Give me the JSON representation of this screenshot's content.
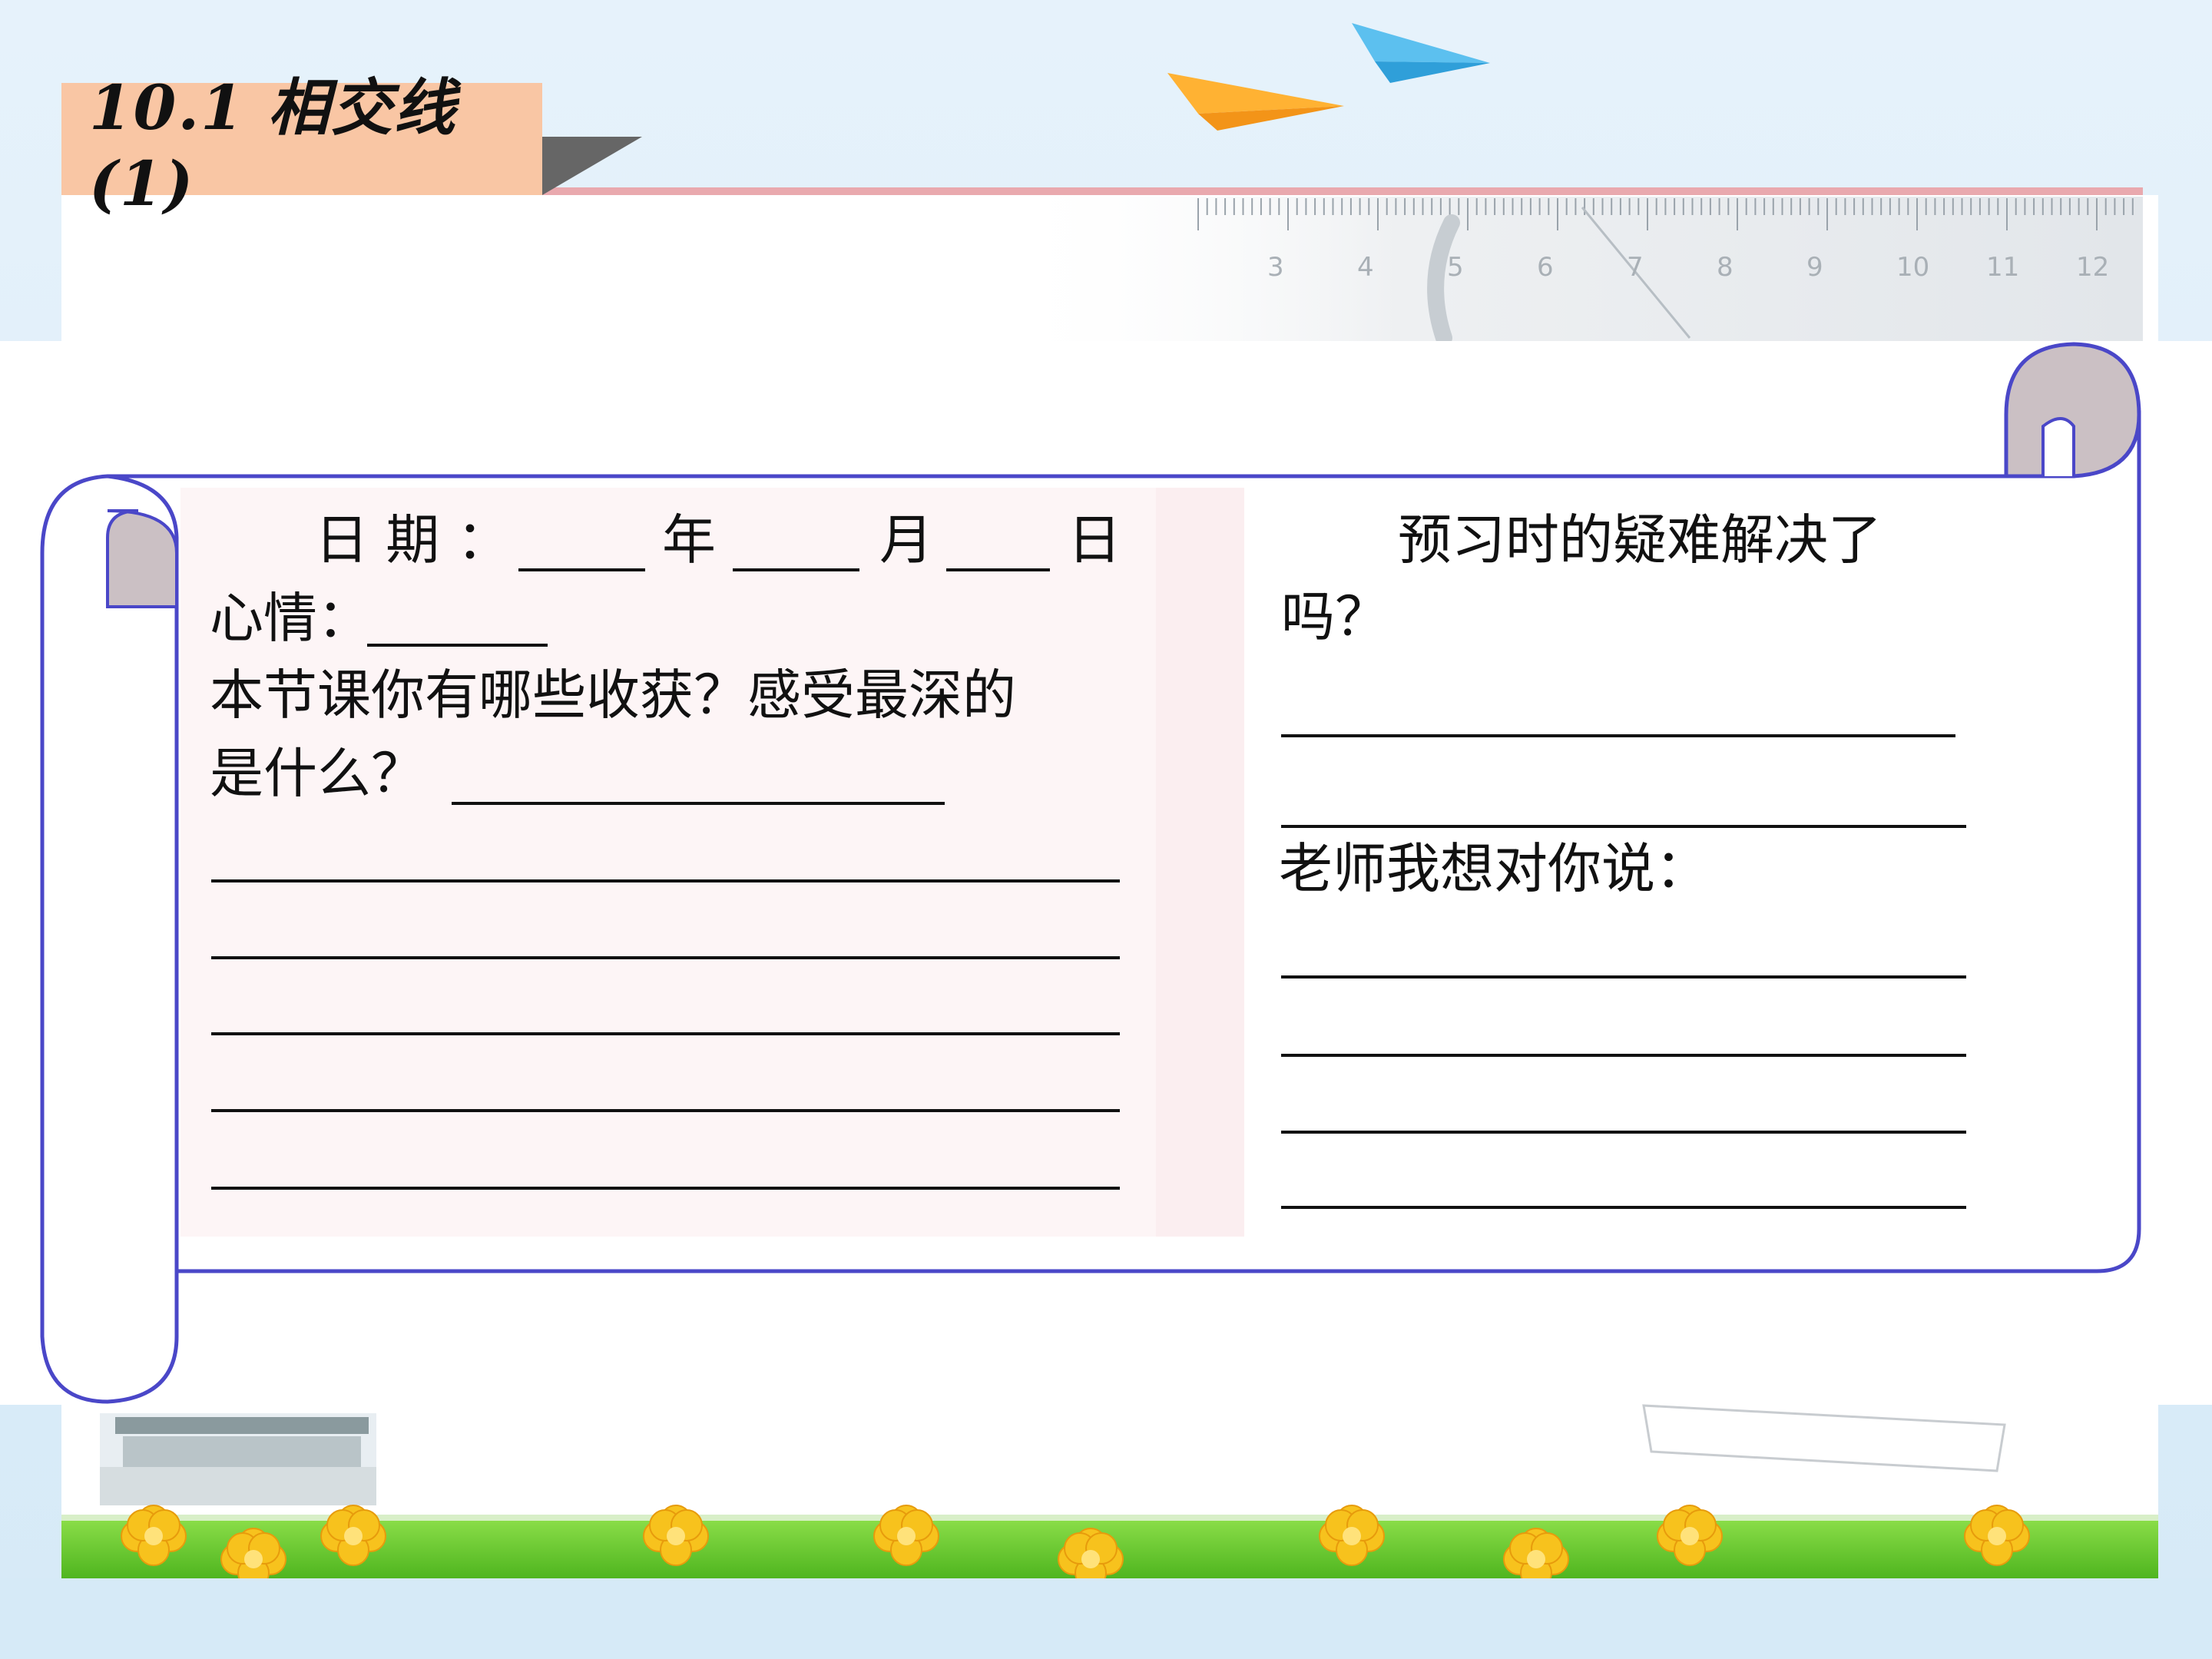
{
  "header": {
    "title": "10.1 相交线(1)"
  },
  "ruler": {
    "numbers": [
      "3",
      "4",
      "5",
      "6",
      "7",
      "8",
      "9",
      "10",
      "11",
      "12"
    ]
  },
  "left_panel": {
    "date_label": "日 期 ：",
    "year_label": "年",
    "month_label": "月",
    "day_label": "日",
    "mood_label": "心情：",
    "question_line1": "本节课你有哪些收获？感受最深的",
    "question_line2": "是什么？"
  },
  "right_panel": {
    "question_line1": "预习时的疑难解决了",
    "question_line2": "吗？",
    "teacher_label": "老师我想对你说："
  },
  "colors": {
    "background": "#dcedf8",
    "title_badge": "#f9c6a4",
    "scroll_outline": "#4a47c8",
    "scroll_curl": "#cbc0c4",
    "ruler_top": "#e9a9ae",
    "grass": "#5fc52a",
    "flower": "#f7c21d"
  },
  "icons": [
    "paper-plane-icon",
    "paper-plane-icon",
    "ruler-icon",
    "bridge-image",
    "flower-border-image"
  ]
}
